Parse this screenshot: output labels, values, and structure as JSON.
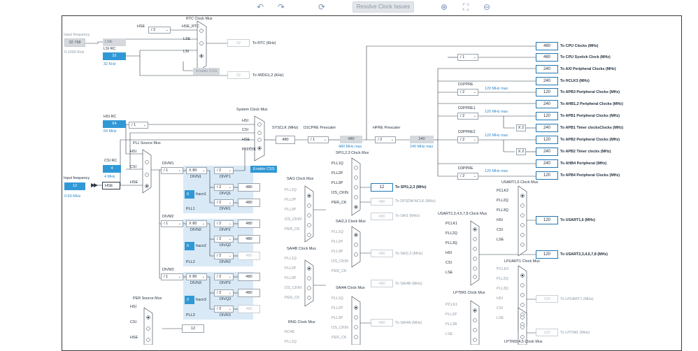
{
  "toolbar": {
    "undo_icon": "undo-icon",
    "redo_icon": "redo-icon",
    "refresh_icon": "refresh-icon",
    "resolve_label": "Resolve Clock Issues",
    "zoom_in_icon": "zoom-in-icon",
    "fit_icon": "fit-icon",
    "zoom_out_icon": "zoom-out-icon"
  },
  "inputs": {
    "lse_freq_label": "Input frequency",
    "lse_freq_value": "32.768",
    "lse_range": "0-1000 KHz",
    "lse_label": "LSE",
    "lsi_label": "LSI RC",
    "lsi_value": "32",
    "lsi_unit": "32 KHz",
    "hsi_label": "HSI RC",
    "hsi_value": "64",
    "hsi_unit": "64 MHz",
    "csi_label": "CSI RC",
    "csi_value": "4",
    "csi_unit": "4 MHz",
    "hse_freq_label": "Input frequency",
    "hse_freq_value": "12",
    "hse_label": "HSE",
    "hse_range": "0-50 MHz"
  },
  "rtc": {
    "title": "RTC Clock Mux",
    "hse_label": "HSE",
    "hse_div": "/ 2",
    "hse_rtc": "HSE_RTC",
    "lse": "LSE",
    "lsi": "LSI",
    "rtc_value": "32",
    "rtc_out": "To RTC (KHz)",
    "enable_css": "Enable CSS",
    "iwdg_value": "32",
    "iwdg_out": "To IWDG1,2 (KHz)"
  },
  "hsi_div": "/ 1",
  "pll_source": {
    "title": "PLL Source Mux",
    "hsi": "HSI",
    "csi": "CSI",
    "hse": "HSE"
  },
  "pll1": {
    "divm_label": "DIVM1",
    "divm": "/ 1",
    "divn": "X 80",
    "divn_label": "DIVN1",
    "divp": "/ 2",
    "divp_label": "DIVP1",
    "divq": "/ 2",
    "divq_label": "DIVQ1",
    "divr": "/ 2",
    "divr_label": "DIVR1",
    "frac": "0",
    "frac_label": "fracn1",
    "name": "PLL1",
    "q_value": "480",
    "r_value": "480"
  },
  "pll2": {
    "divm_label": "DIVM2",
    "divm": "/ 1",
    "divn": "X 80",
    "divn_label": "DIVN2",
    "divp": "/ 2",
    "divp_label": "DIVP2",
    "divq": "/ 2",
    "divq_label": "DIVQ2",
    "divr": "/ 2",
    "divr_label": "DIVR2",
    "frac": "0",
    "frac_label": "fracn2",
    "name": "PLL2",
    "p_value": "480",
    "q_value": "480",
    "r_value": "480"
  },
  "pll3": {
    "divm_label": "DIVM3",
    "divm": "/ 1",
    "divn": "X 80",
    "divn_label": "DIVN3",
    "divp": "/ 2",
    "divp_label": "DIVP3",
    "divq": "/ 2",
    "divq_label": "DIVQ3",
    "divr": "/ 2",
    "divr_label": "DIVR3",
    "frac": "0",
    "frac_label": "fracn3",
    "name": "PLL3",
    "p_value": "480",
    "q_value": "480",
    "r_value": "480"
  },
  "sysclk_mux": {
    "title": "System Clock Mux",
    "hsi": "HSI",
    "csi": "CSI",
    "hse": "HSE",
    "pllclk": "PLLCLK",
    "enable_css": "Enable CSS",
    "sysclk_label": "SYSCLK (MHz)",
    "sysclk_value": "480"
  },
  "d1cpre": {
    "label": "D1CPRE Prescaler",
    "div": "/ 1",
    "value": "480",
    "max": "480 MHz max"
  },
  "hpre": {
    "label": "HPRE Prescaler",
    "div": "/ 2",
    "value": "240",
    "max": "240 MHz max"
  },
  "systick_div": "/ 1",
  "d1ppre": {
    "label": "D1PPRE",
    "div": "/ 2",
    "max": "120 MHz max"
  },
  "d2ppre1": {
    "label": "D2PPRE1",
    "div": "/ 2",
    "max": "120 MHz max"
  },
  "d2ppre2": {
    "label": "D2PPRE2",
    "div": "/ 2",
    "max": "120 MHz max"
  },
  "d3ppre": {
    "label": "D3PPRE",
    "div": "/ 2",
    "max": "120 MHz max"
  },
  "mult_x2": "X 2",
  "outputs": [
    {
      "value": "480",
      "label": "To CPU Clocks (MHz)"
    },
    {
      "value": "480",
      "label": "To CPU Systick Clock (MHz)"
    },
    {
      "value": "240",
      "label": "To AXI Peripheral Clocks (MHz)"
    },
    {
      "value": "240",
      "label": "To HCLK3 (MHz)"
    },
    {
      "value": "120",
      "label": "To APB3 Peripheral Clocks (MHz)"
    },
    {
      "value": "240",
      "label": "To AHB1,2 Peripheral Clocks (MHz)"
    },
    {
      "value": "120",
      "label": "To APB1 Peripheral Clocks (MHz)"
    },
    {
      "value": "240",
      "label": "To APB1 Timer clocksClocks (MHz)"
    },
    {
      "value": "120",
      "label": "To APB2 Peripheral Clocks (MHz)"
    },
    {
      "value": "240",
      "label": "To APB2 Timer clocks (MHz)"
    },
    {
      "value": "240",
      "label": "To AHB4 Peripheral (MHz)"
    },
    {
      "value": "120",
      "label": "To APB4 Peripheral Clocks (MHz)"
    }
  ],
  "spi123": {
    "title": "SPI1,2,3 Clock Mux",
    "inputs": [
      "PLL1Q",
      "PLL2P",
      "PLL3P",
      "I2S_CKIN",
      "PER_CK"
    ],
    "value": "12",
    "out": "To SPI1,2,3 (MHz)",
    "dfsdm_value": "480",
    "dfsdm_out": "To DFSDM ACLK (MHz)"
  },
  "sai1": {
    "title": "SAI1 Clock Mux",
    "inputs": [
      "PLL1Q",
      "PLL2P",
      "PLL3P",
      "I2S_CKIN",
      "PER_CK"
    ],
    "value": "480",
    "out": "To SAI1 (MHz)"
  },
  "sai23": {
    "title": "SAI2,3 Clock Mux",
    "inputs": [
      "PLL1Q",
      "PLL2P",
      "PLL3P",
      "I2S_CKIN",
      "PER_CK"
    ],
    "value": "480",
    "out": "To SAI2,3 (MHz)"
  },
  "sai4b": {
    "title": "SAI4B Clock Mux",
    "inputs": [
      "PLL1Q",
      "PLL2P",
      "PLL3P",
      "I2S_CKIN",
      "PER_CK"
    ],
    "value": "480",
    "out": "To SAI4B (MHz)"
  },
  "sai4a": {
    "title": "SAI4A Clock Mux",
    "inputs": [
      "PLL1Q",
      "PLL2P",
      "PLL3P",
      "I2S_CKIN",
      "PER_CK"
    ],
    "value": "480",
    "out": "To SAI4A (MHz)"
  },
  "rng": {
    "title": "RNG Clock Mux",
    "inputs": [
      "RC48",
      "PLL1Q"
    ]
  },
  "usart16": {
    "title": "USART1,6 Clock Mux",
    "inputs": [
      "PCLK2",
      "PLL2Q",
      "PLL3Q",
      "HSI",
      "CSI",
      "LSE"
    ],
    "value": "120",
    "out": "To USART1,6 (MHz)"
  },
  "usart23": {
    "title": "USART2,3,4,5,7,8 Clock Mux",
    "inputs": [
      "PCLK1",
      "PLL2Q",
      "PLL3Q",
      "HSI",
      "CSI",
      "LSE"
    ],
    "value": "120",
    "out": "To USART2,3,4,5,7,8 (MHz)"
  },
  "lpuart1": {
    "title": "LPUART1 Clock Mux",
    "inputs": [
      "PCLK3",
      "PLL2Q",
      "PLL3Q",
      "HSI",
      "CSI",
      "LSE"
    ],
    "value": "120",
    "out": "To LPUART1 (MHz)"
  },
  "lptim1": {
    "title": "LPTIM1 Clock Mux",
    "inputs": [
      "PCLK1",
      "PLL2P",
      "PLL3R",
      "LSE"
    ]
  },
  "lptim345": {
    "title": "LPTIM3,4,5 Clock Mux",
    "value": "120",
    "out": "To LPTIM1 (MHz)"
  },
  "per": {
    "title": "PER Source Mux",
    "inputs": [
      "HSI",
      "CSI",
      "HSE"
    ],
    "value": "12"
  }
}
